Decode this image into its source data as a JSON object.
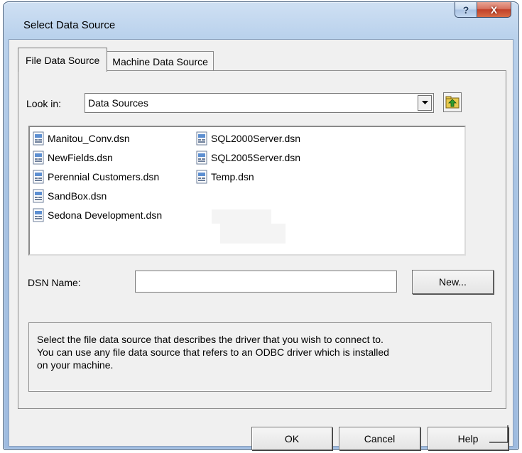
{
  "window": {
    "title": "Select Data Source",
    "help_caption": "?",
    "close_caption": "X"
  },
  "tabs": [
    {
      "label": "File Data Source",
      "active": true
    },
    {
      "label": "Machine Data Source",
      "active": false
    }
  ],
  "look_in": {
    "label": "Look in:",
    "value": "Data Sources",
    "dropdown_icon": "chevron-down-icon",
    "up_icon": "folder-up-icon"
  },
  "files": {
    "column1": [
      {
        "name": "Manitou_Conv.dsn"
      },
      {
        "name": "NewFields.dsn"
      },
      {
        "name": "Perennial Customers.dsn"
      },
      {
        "name": "SandBox.dsn"
      },
      {
        "name": "Sedona Development.dsn"
      }
    ],
    "column2": [
      {
        "name": "SQL2000Server.dsn"
      },
      {
        "name": "SQL2005Server.dsn"
      },
      {
        "name": "Temp.dsn"
      }
    ],
    "icon": "dsn-file-icon"
  },
  "dsn": {
    "label": "DSN Name:",
    "value": "",
    "new_button": "New..."
  },
  "description": {
    "lines": [
      "Select the file data source that describes the driver that you wish to connect to.",
      "You can use any file data source that refers to an ODBC driver which is installed",
      "on your machine."
    ]
  },
  "buttons": {
    "ok": "OK",
    "cancel": "Cancel",
    "help": "Help"
  },
  "colors": {
    "frame": "#a9c4e4",
    "client": "#f0f0f0",
    "close_button": "#c2412a"
  }
}
